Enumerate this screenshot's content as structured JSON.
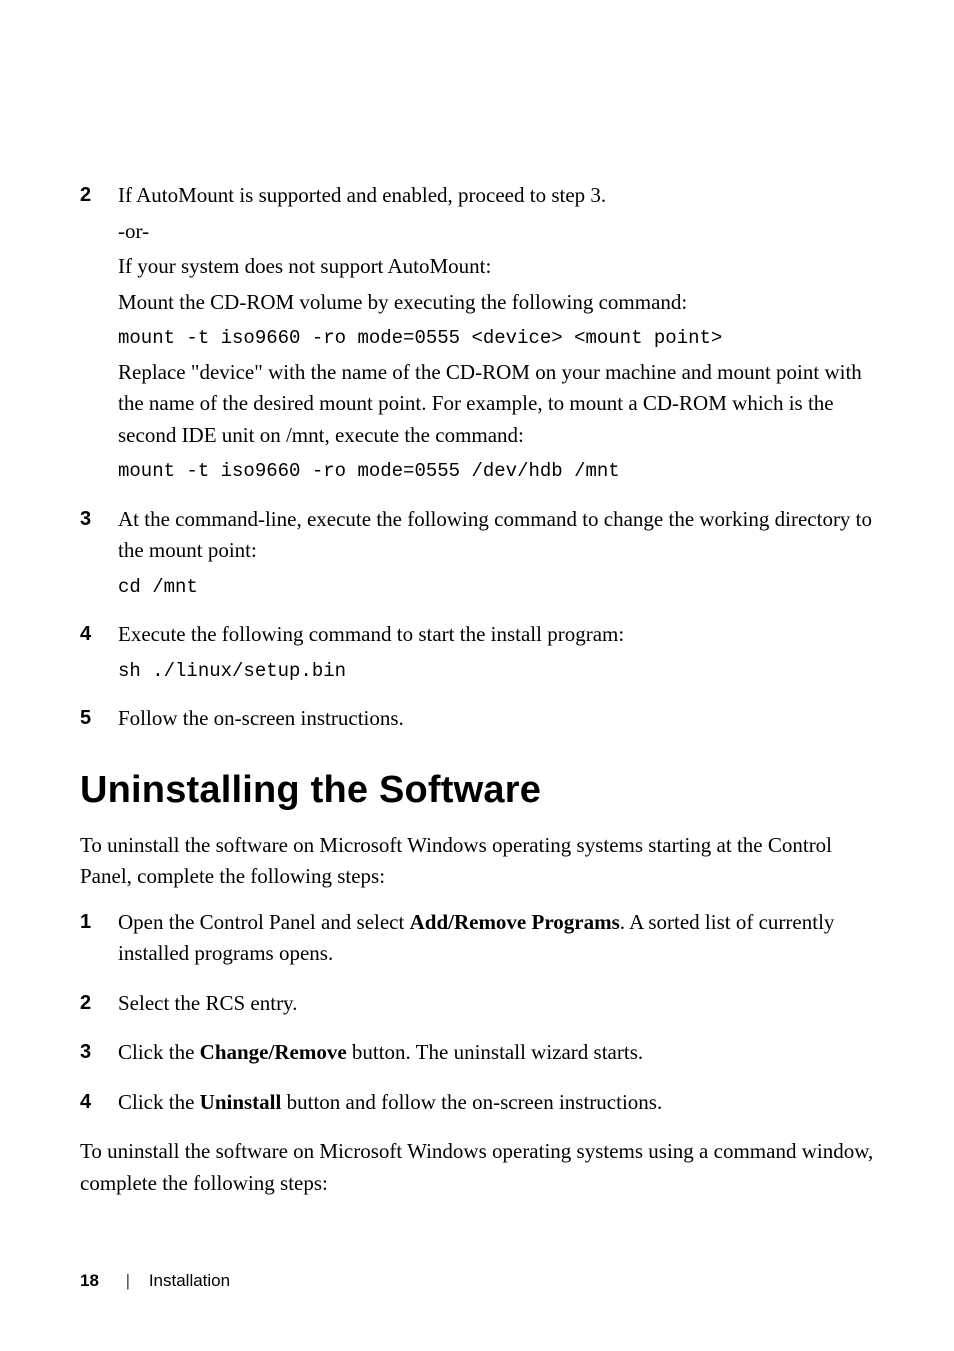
{
  "steps_a": [
    {
      "num": "2",
      "paras": [
        {
          "t": "text",
          "v": "If AutoMount is supported and enabled, proceed to step 3."
        },
        {
          "t": "text",
          "v": "-or-"
        },
        {
          "t": "text",
          "v": "If your system does not support AutoMount:"
        },
        {
          "t": "text",
          "v": "Mount the CD-ROM volume by executing the following command:"
        },
        {
          "t": "code",
          "v": "mount -t iso9660 -ro mode=0555 <device> <mount point>"
        },
        {
          "t": "text",
          "v": "Replace \"device\" with the name of the CD-ROM on your machine and mount point with the name of the desired mount point. For example, to mount a CD-ROM which is the second IDE unit on /mnt, execute the command:"
        },
        {
          "t": "code",
          "v": "mount -t iso9660 -ro mode=0555 /dev/hdb /mnt"
        }
      ]
    },
    {
      "num": "3",
      "paras": [
        {
          "t": "text",
          "v": "At the command-line, execute the following command to change the working directory to the mount point:"
        },
        {
          "t": "code",
          "v": "cd /mnt"
        }
      ]
    },
    {
      "num": "4",
      "paras": [
        {
          "t": "text",
          "v": "Execute the following command to start the install program:"
        },
        {
          "t": "code",
          "v": "sh ./linux/setup.bin"
        }
      ]
    },
    {
      "num": "5",
      "paras": [
        {
          "t": "text",
          "v": "Follow the on-screen instructions."
        }
      ]
    }
  ],
  "heading": "Uninstalling the Software",
  "intro": "To uninstall the software on Microsoft Windows operating systems starting at the Control Panel, complete the following steps:",
  "steps_b": [
    {
      "num": "1",
      "runs": [
        {
          "t": "plain",
          "v": "Open the Control Panel and select "
        },
        {
          "t": "bold",
          "v": "Add/Remove Programs"
        },
        {
          "t": "plain",
          "v": ". A sorted list of currently installed programs opens."
        }
      ]
    },
    {
      "num": "2",
      "runs": [
        {
          "t": "plain",
          "v": "Select the RCS entry."
        }
      ]
    },
    {
      "num": "3",
      "runs": [
        {
          "t": "plain",
          "v": "Click the "
        },
        {
          "t": "bold",
          "v": "Change/Remove"
        },
        {
          "t": "plain",
          "v": " button. The uninstall wizard starts."
        }
      ]
    },
    {
      "num": "4",
      "runs": [
        {
          "t": "plain",
          "v": "Click the "
        },
        {
          "t": "bold",
          "v": "Uninstall"
        },
        {
          "t": "plain",
          "v": " button and follow the on-screen instructions."
        }
      ]
    }
  ],
  "outro": "To uninstall the software on Microsoft Windows operating systems using a command window, complete the following steps:",
  "footer": {
    "page": "18",
    "sep": "|",
    "section": "Installation"
  }
}
